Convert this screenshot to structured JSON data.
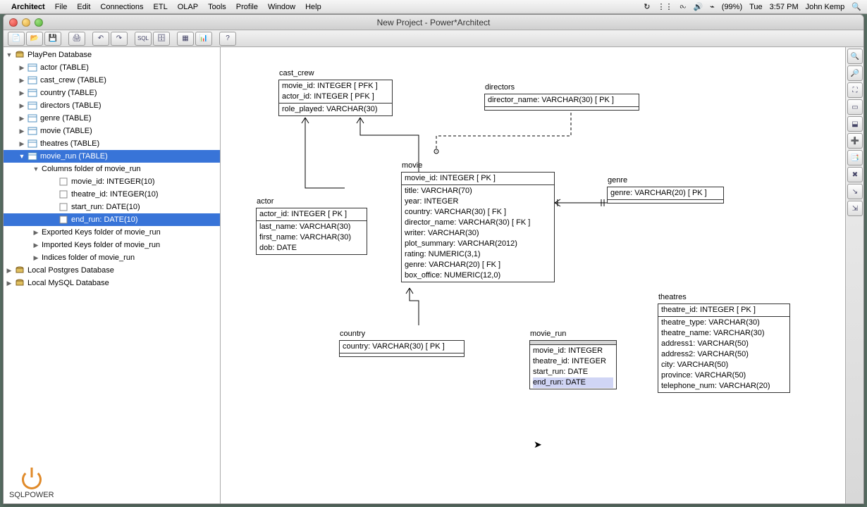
{
  "menubar": {
    "app": "Architect",
    "items": [
      "File",
      "Edit",
      "Connections",
      "ETL",
      "OLAP",
      "Tools",
      "Profile",
      "Window",
      "Help"
    ],
    "right": {
      "battery": "(99%)",
      "day": "Tue",
      "time": "3:57 PM",
      "user": "John Kemp"
    }
  },
  "window": {
    "title": "New Project - Power*Architect"
  },
  "toolbar": {
    "btns": [
      "new",
      "open",
      "save",
      "print",
      "undo",
      "redo",
      "sql",
      "db",
      "grid",
      "chart",
      "help"
    ]
  },
  "tree": {
    "root": "PlayPen Database",
    "tables": [
      "actor (TABLE)",
      "cast_crew (TABLE)",
      "country (TABLE)",
      "directors (TABLE)",
      "genre (TABLE)",
      "movie (TABLE)",
      "theatres (TABLE)"
    ],
    "selected_table": "movie_run (TABLE)",
    "cols_folder": "Columns folder of movie_run",
    "cols": [
      "movie_id: INTEGER(10)",
      "theatre_id: INTEGER(10)",
      "start_run: DATE(10)"
    ],
    "selected_col": "end_run: DATE(10)",
    "folders": [
      "Exported Keys folder of movie_run",
      "Imported Keys folder of movie_run",
      "Indices folder of movie_run"
    ],
    "other_dbs": [
      "Local Postgres Database",
      "Local MySQL Database"
    ]
  },
  "entities": {
    "cast_crew": {
      "name": "cast_crew",
      "pk": [
        "movie_id: INTEGER  [ PFK ]",
        "actor_id: INTEGER  [ PFK ]"
      ],
      "cols": [
        "role_played: VARCHAR(30)"
      ]
    },
    "directors": {
      "name": "directors",
      "pk": [
        "director_name: VARCHAR(30)  [ PK ]"
      ],
      "cols": []
    },
    "actor": {
      "name": "actor",
      "pk": [
        "actor_id: INTEGER  [ PK ]"
      ],
      "cols": [
        "last_name: VARCHAR(30)",
        "first_name: VARCHAR(30)",
        "dob: DATE"
      ]
    },
    "movie": {
      "name": "movie",
      "pk": [
        "movie_id: INTEGER  [ PK ]"
      ],
      "cols": [
        "title: VARCHAR(70)",
        "year: INTEGER",
        "country: VARCHAR(30)  [ FK ]",
        "director_name: VARCHAR(30)  [ FK ]",
        "writer: VARCHAR(30)",
        "plot_summary: VARCHAR(2012)",
        "rating: NUMERIC(3,1)",
        "genre: VARCHAR(20)  [ FK ]",
        "box_office: NUMERIC(12,0)"
      ]
    },
    "genre": {
      "name": "genre",
      "pk": [
        "genre: VARCHAR(20)  [ PK ]"
      ],
      "cols": []
    },
    "country": {
      "name": "country",
      "pk": [
        "country: VARCHAR(30)  [ PK ]"
      ],
      "cols": []
    },
    "movie_run": {
      "name": "movie_run",
      "pk": [],
      "cols": [
        "movie_id: INTEGER",
        "theatre_id: INTEGER",
        "start_run: DATE",
        "end_run: DATE"
      ]
    },
    "theatres": {
      "name": "theatres",
      "pk": [
        "theatre_id: INTEGER  [ PK ]"
      ],
      "cols": [
        "theatre_type: VARCHAR(30)",
        "theatre_name: VARCHAR(30)",
        "address1: VARCHAR(50)",
        "address2: VARCHAR(50)",
        "city: VARCHAR(50)",
        "province: VARCHAR(50)",
        "telephone_num: VARCHAR(20)"
      ]
    }
  },
  "logo": "SQLPOWER"
}
